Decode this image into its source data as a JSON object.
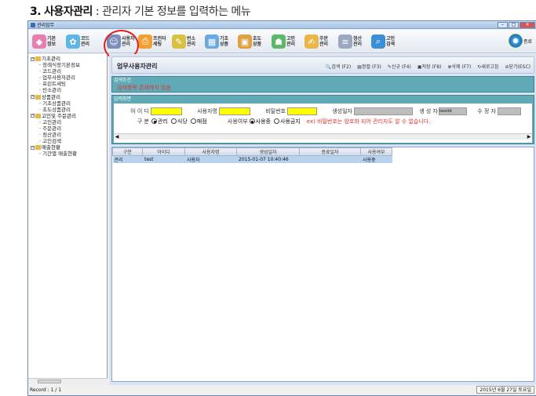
{
  "heading": {
    "number": "3.",
    "bold": "사용자관리",
    "sep": " : ",
    "desc": "관리자 기본 정보를 입력하는 메뉴"
  },
  "window": {
    "title": "관리업무"
  },
  "toolbar": {
    "buttons": [
      {
        "l1": "기본",
        "l2": "정보",
        "color": "#e67fb0"
      },
      {
        "l1": "코드",
        "l2": "관리",
        "color": "#5fb6e4"
      },
      {
        "l1": "사용자",
        "l2": "관리",
        "color": "#7c8dbd"
      },
      {
        "l1": "프린터",
        "l2": "세팅",
        "color": "#f0a030"
      },
      {
        "l1": "번소",
        "l2": "관리",
        "color": "#d8c040"
      },
      {
        "l1": "기초",
        "l2": "상품",
        "color": "#6aa8e0"
      },
      {
        "l1": "초도",
        "l2": "상품",
        "color": "#e0a040"
      },
      {
        "l1": "고인",
        "l2": "관리",
        "color": "#5fb86a"
      },
      {
        "l1": "주문",
        "l2": "관리",
        "color": "#e8b64a"
      },
      {
        "l1": "정산",
        "l2": "관리",
        "color": "#9aa8c0"
      },
      {
        "l1": "고인",
        "l2": "검색",
        "color": "#3a8fd6"
      }
    ],
    "exit_label": "종료"
  },
  "tree": [
    {
      "level": 0,
      "label": "기초관리"
    },
    {
      "level": 1,
      "label": "장례식장기본정보"
    },
    {
      "level": 1,
      "label": "코드관리"
    },
    {
      "level": 1,
      "label": "업무사용자관리"
    },
    {
      "level": 1,
      "label": "프린트세팅"
    },
    {
      "level": 1,
      "label": "빈소관리"
    },
    {
      "level": 0,
      "label": "상품관리"
    },
    {
      "level": 1,
      "label": "기초상품관리"
    },
    {
      "level": 1,
      "label": "초도상품관리"
    },
    {
      "level": 0,
      "label": "고인및 주문관리"
    },
    {
      "level": 1,
      "label": "고인관리"
    },
    {
      "level": 1,
      "label": "주문관리"
    },
    {
      "level": 1,
      "label": "정산관리"
    },
    {
      "level": 1,
      "label": "고인검색"
    },
    {
      "level": 0,
      "label": "매출현황"
    },
    {
      "level": 1,
      "label": "기간별 매출현황"
    }
  ],
  "status": {
    "record": "Record : 1 / 1",
    "date": "2015년 6월 27일 토요일"
  },
  "main": {
    "title": "업무사용자관리",
    "actions": [
      {
        "icon": "search-icon",
        "glyph": "🔍",
        "label": "검색 (F2)"
      },
      {
        "icon": "sort-icon",
        "glyph": "▤",
        "label": "정렬 (F3)"
      },
      {
        "icon": "new-icon",
        "glyph": "✎",
        "label": "신규 (F4)"
      },
      {
        "icon": "save-icon",
        "glyph": "▣",
        "label": "저장 (F8)"
      },
      {
        "icon": "delete-icon",
        "glyph": "⊗",
        "label": "삭제 (F7)"
      },
      {
        "icon": "refresh-icon",
        "glyph": "↻",
        "label": "새로고침"
      },
      {
        "icon": "close-icon",
        "glyph": "⊘",
        "label": "닫기(ESC)"
      }
    ],
    "search": {
      "title": "검색조건",
      "message": "검색항목 존재하지 않음"
    },
    "input": {
      "title": "입력화면",
      "id_label": "아 이 디",
      "username_label": "사용자명",
      "password_label": "비밀번호",
      "created_label": "생성일자",
      "creator_label": "생 성 자",
      "creator_value": "testid",
      "modifier_label": "수 정 자",
      "type_label": "구   분",
      "type_options": [
        "관리",
        "식당",
        "매점"
      ],
      "type_selected": 0,
      "use_label": "사용여부",
      "use_options": [
        "사용중",
        "사용금지"
      ],
      "use_selected": 0,
      "note": "ex) 비밀번호는 암호화 되어 관리자도 알 수 없습니다."
    },
    "grid": {
      "columns": [
        "구분",
        "아이디",
        "사용자명",
        "생성일자",
        "종료일자",
        "사용여부"
      ],
      "rows": [
        [
          "관리",
          "test",
          "사용자",
          "2015-01-07 10:40:46",
          "",
          "사용중"
        ]
      ]
    }
  }
}
